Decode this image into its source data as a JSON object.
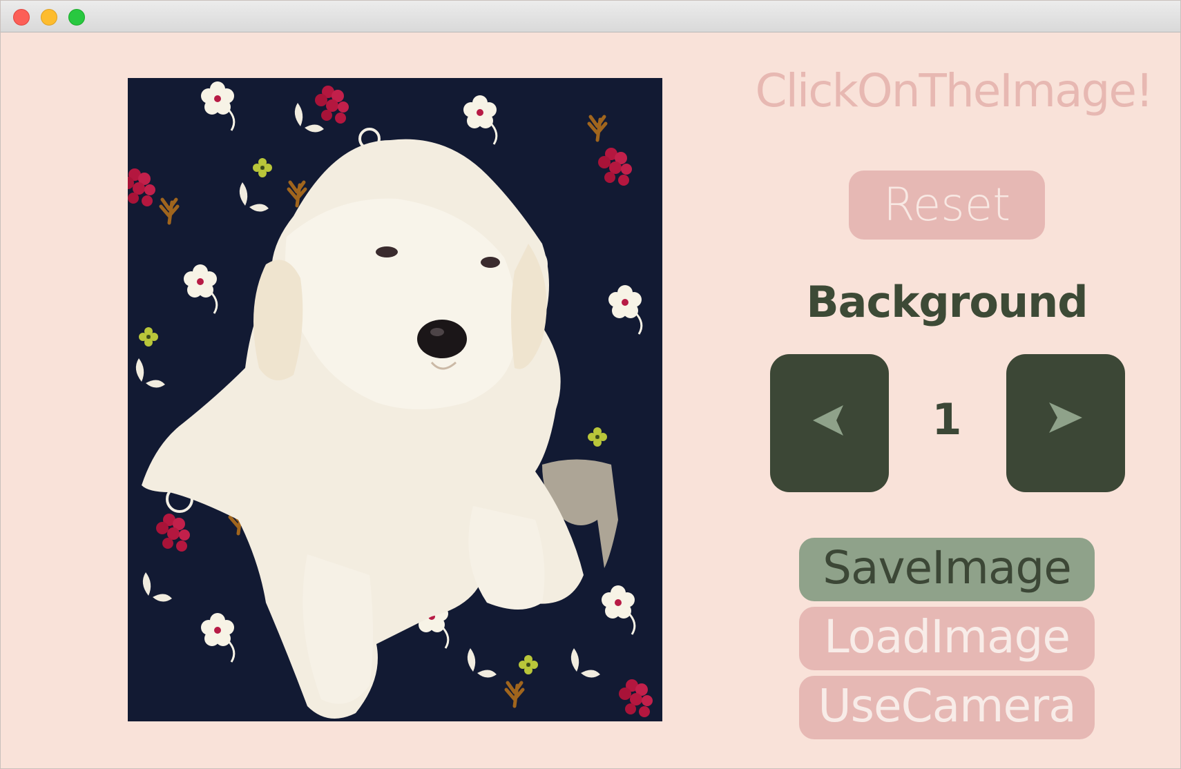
{
  "window": {
    "hint_text": "ClickOnTheImage!",
    "reset_label": "Reset",
    "background_label": "Background",
    "background_index": "1",
    "save_label": "SaveImage",
    "load_label": "LoadImage",
    "camera_label": "UseCamera"
  },
  "colors": {
    "window_bg": "#f9e2d9",
    "pink_button": "#e6b8b4",
    "dark_green": "#3c4736",
    "sage_green": "#8fa28a",
    "hint_pink": "#e7b8b2",
    "canvas_bg": "#121a33"
  },
  "icons": {
    "prev": "arrow-left-icon",
    "next": "arrow-right-icon"
  }
}
